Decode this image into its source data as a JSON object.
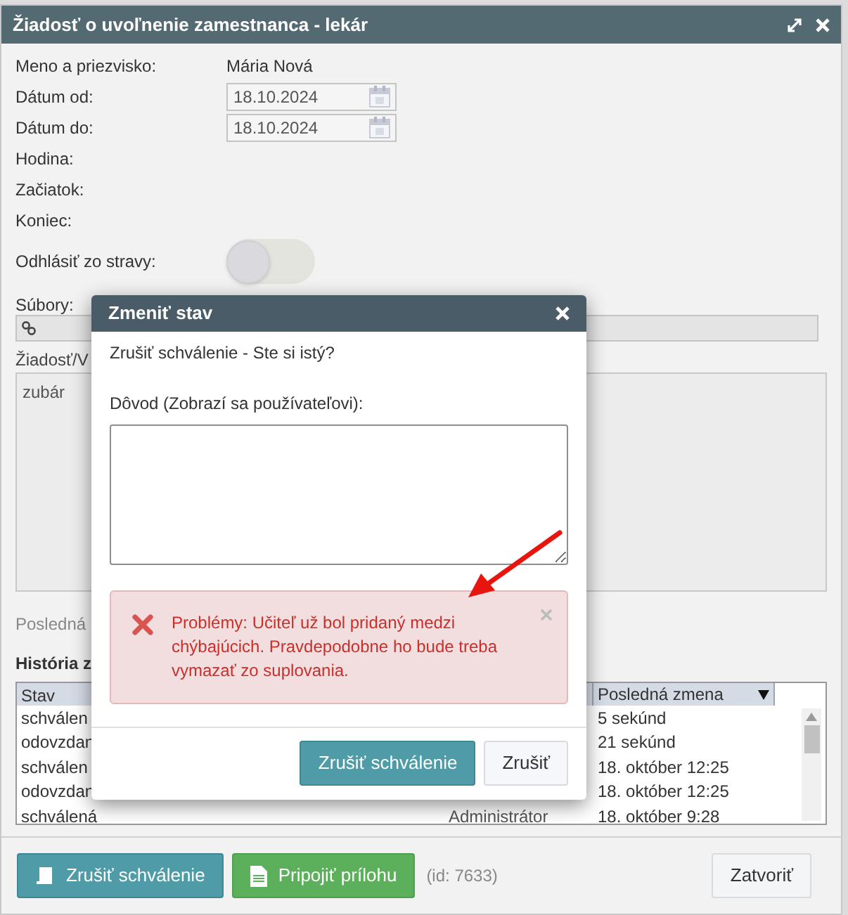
{
  "window": {
    "title": "Žiadosť o uvoľnenie zamestnanca - lekár"
  },
  "form": {
    "fields": [
      {
        "kind": "text",
        "label": "Meno a priezvisko:",
        "value": "Mária Nová"
      },
      {
        "kind": "date",
        "label": "Dátum od:",
        "value": "18.10.2024"
      },
      {
        "kind": "date",
        "label": "Dátum do:",
        "value": "18.10.2024"
      },
      {
        "kind": "empty",
        "label": "Hodina:"
      },
      {
        "kind": "empty",
        "label": "Začiatok:"
      },
      {
        "kind": "empty",
        "label": "Koniec:"
      },
      {
        "kind": "toggle",
        "label": "Odhlásiť zo stravy:",
        "on": false
      }
    ],
    "files_label": "Súbory:",
    "request_label": "Žiadosť/V",
    "request_value": "zubár",
    "last_change_label": "Posledná",
    "history_label": "História z"
  },
  "history": {
    "columns": [
      "Stav",
      "Posledná zmena"
    ],
    "rows": [
      {
        "status": "schválen",
        "time": "5 sekúnd"
      },
      {
        "status": "odovzdan",
        "time": "21 sekúnd"
      },
      {
        "status": "schválen",
        "time": "18. október 12:25"
      },
      {
        "status": "odovzdan",
        "time": "18. október 12:25"
      },
      {
        "status": "schválená",
        "user": "Administrátor",
        "time": "18. október 9:28"
      }
    ]
  },
  "footer": {
    "buttons": [
      {
        "kind": "primary",
        "label": "Zrušiť schválenie"
      },
      {
        "kind": "success",
        "label": "Pripojiť prílohu"
      }
    ],
    "id_text": "(id: 7633)",
    "close": "Zatvoriť"
  },
  "dialog": {
    "title": "Zmeniť stav",
    "question": "Zrušiť schválenie - Ste si istý?",
    "reason_label": "Dôvod (Zobrazí sa používateľovi):",
    "alert": "Problémy: Učiteľ už bol pridaný medzi chýbajúcich. Pravdepodobne ho bude treba vymazať zo suplovania.",
    "buttons": [
      {
        "kind": "primary",
        "label": "Zrušiť schválenie"
      },
      {
        "kind": "default",
        "label": "Zrušiť"
      }
    ]
  }
}
